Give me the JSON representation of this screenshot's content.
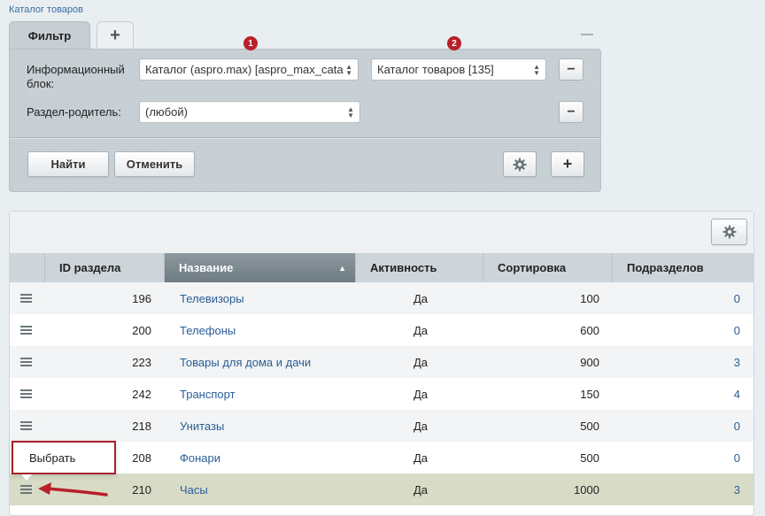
{
  "breadcrumb": "Каталог товаров",
  "filter": {
    "tab_label": "Фильтр",
    "add_tab": "+",
    "iblock_label": "Информационный блок:",
    "iblock_value": "Каталог (aspro.max) [aspro_max_cata",
    "iblock2_value": "Каталог товаров [135]",
    "parent_label": "Раздел-родитель:",
    "parent_value": "(любой)",
    "minus": "−",
    "plus": "+",
    "find_button": "Найти",
    "cancel_button": "Отменить",
    "badge1": "1",
    "badge2": "2"
  },
  "table": {
    "columns": [
      "ID раздела",
      "Название",
      "Активность",
      "Сортировка",
      "Подразделов"
    ],
    "sort_arrow": "▲",
    "rows": [
      {
        "id": "196",
        "name": "Телевизоры",
        "active": "Да",
        "sort": "100",
        "sub": "0"
      },
      {
        "id": "200",
        "name": "Телефоны",
        "active": "Да",
        "sort": "600",
        "sub": "0"
      },
      {
        "id": "223",
        "name": "Товары для дома и дачи",
        "active": "Да",
        "sort": "900",
        "sub": "3"
      },
      {
        "id": "242",
        "name": "Транспорт",
        "active": "Да",
        "sort": "150",
        "sub": "4"
      },
      {
        "id": "218",
        "name": "Унитазы",
        "active": "Да",
        "sort": "500",
        "sub": "0"
      },
      {
        "id": "208",
        "name": "Фонари",
        "active": "Да",
        "sort": "500",
        "sub": "0"
      },
      {
        "id": "210",
        "name": "Часы",
        "active": "Да",
        "sort": "1000",
        "sub": "3"
      }
    ]
  },
  "context_menu": {
    "select_label": "Выбрать"
  },
  "colors": {
    "accent_red": "#b8202a",
    "link": "#2b5d95",
    "selected_row": "#d8dcc6"
  }
}
